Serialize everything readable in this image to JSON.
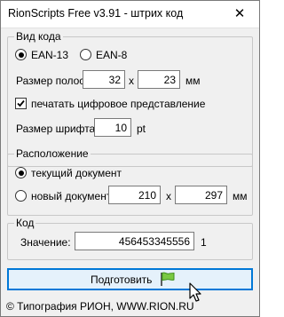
{
  "window": {
    "title": "RionScripts Free v3.91 - штрих код",
    "close_glyph": "✕"
  },
  "barcode_type": {
    "legend": "Вид кода",
    "options": [
      {
        "label": "EAN-13",
        "checked": true
      },
      {
        "label": "EAN-8",
        "checked": false
      }
    ],
    "bar_size_label": "Размер полос:",
    "bar_width": "32",
    "times": "x",
    "bar_height": "23",
    "unit_mm": "мм",
    "print_digital_label": "печатать цифровое представление",
    "print_digital_checked": true,
    "font_size_label": "Размер шрифта:",
    "font_size": "10",
    "unit_pt": "pt"
  },
  "placement": {
    "legend": "Расположение",
    "current_doc_label": "текущий документ",
    "current_doc_checked": true,
    "new_doc_label": "новый документ",
    "new_doc_checked": false,
    "width": "210",
    "times": "x",
    "height": "297",
    "unit_mm": "мм"
  },
  "code": {
    "legend": "Код",
    "value_label": "Значение:",
    "value": "456453345556",
    "check_digit": "1"
  },
  "action": {
    "prepare_label": "Подготовить",
    "flag_icon": "green-flag-icon",
    "accent": "#0078d7"
  },
  "footer": {
    "text": "© Типография РИОН,  WWW.RION.RU"
  }
}
